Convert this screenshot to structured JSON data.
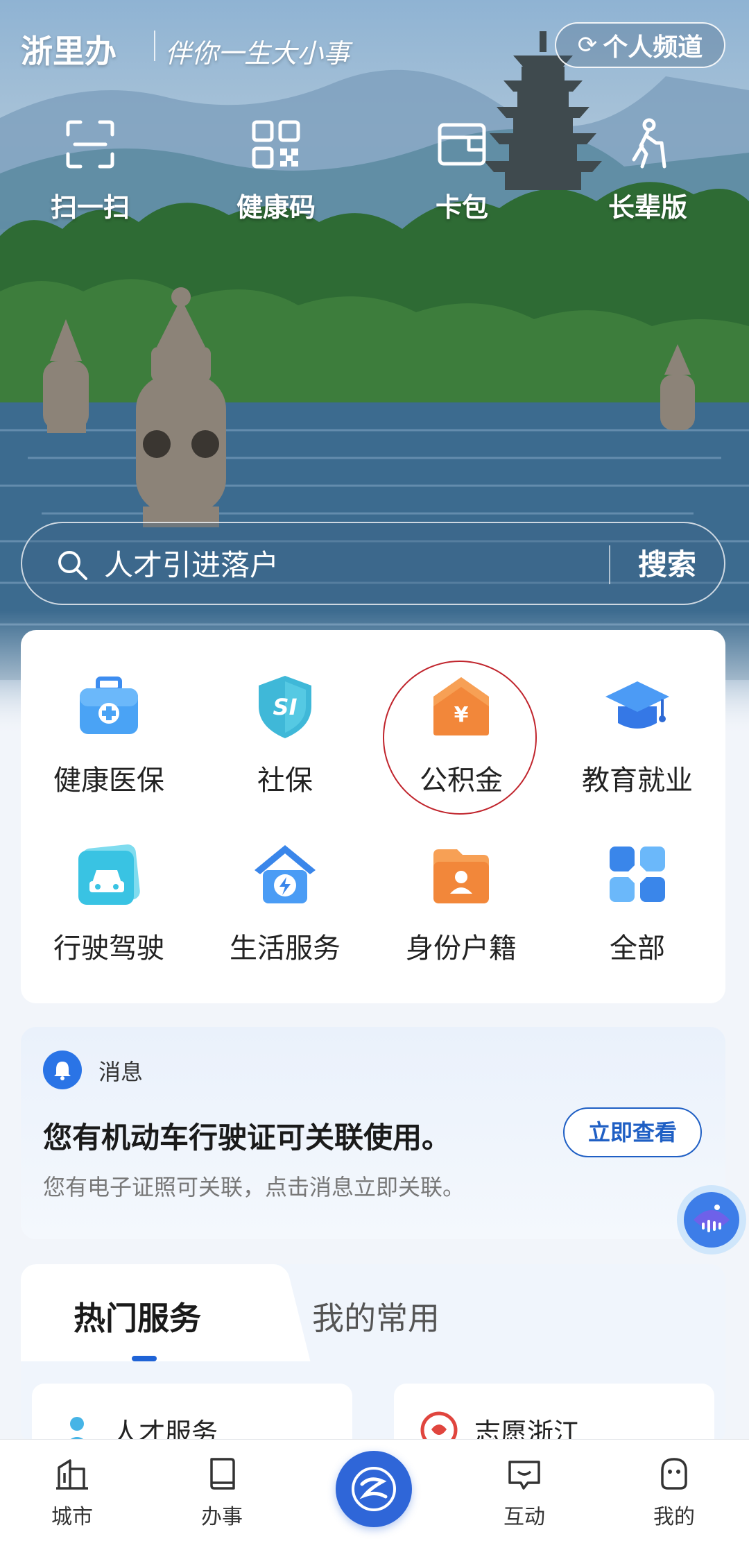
{
  "app": {
    "brand": "浙里办",
    "slogan": "伴你一生大小事",
    "channel_button": "个人频道"
  },
  "quick_actions": [
    {
      "label": "扫一扫",
      "icon": "scan-icon"
    },
    {
      "label": "健康码",
      "icon": "qr-code-icon"
    },
    {
      "label": "卡包",
      "icon": "wallet-icon"
    },
    {
      "label": "长辈版",
      "icon": "elder-icon"
    }
  ],
  "search": {
    "placeholder": "人才引进落户",
    "button": "搜索"
  },
  "services": [
    {
      "label": "健康医保",
      "icon": "medical-kit-icon"
    },
    {
      "label": "社保",
      "icon": "social-security-shield-icon"
    },
    {
      "label": "公积金",
      "icon": "housing-fund-icon"
    },
    {
      "label": "教育就业",
      "icon": "graduation-cap-icon"
    },
    {
      "label": "行驶驾驶",
      "icon": "car-icon"
    },
    {
      "label": "生活服务",
      "icon": "home-energy-icon"
    },
    {
      "label": "身份户籍",
      "icon": "id-folder-icon"
    },
    {
      "label": "全部",
      "icon": "all-grid-icon"
    }
  ],
  "message": {
    "tag": "消息",
    "title": "您有机动车行驶证可关联使用。",
    "subtitle": "您有电子证照可关联，点击消息立即关联。",
    "button": "立即查看"
  },
  "tabs": {
    "active": "热门服务",
    "inactive": "我的常用",
    "cards": [
      {
        "label": "人才服务"
      },
      {
        "label": "志愿浙江"
      }
    ]
  },
  "bottom_nav": [
    {
      "label": "城市"
    },
    {
      "label": "办事"
    },
    {
      "label": "互动"
    },
    {
      "label": "我的"
    }
  ],
  "colors": {
    "accent_blue": "#2f66d8",
    "highlight_ring": "#c0242c"
  }
}
